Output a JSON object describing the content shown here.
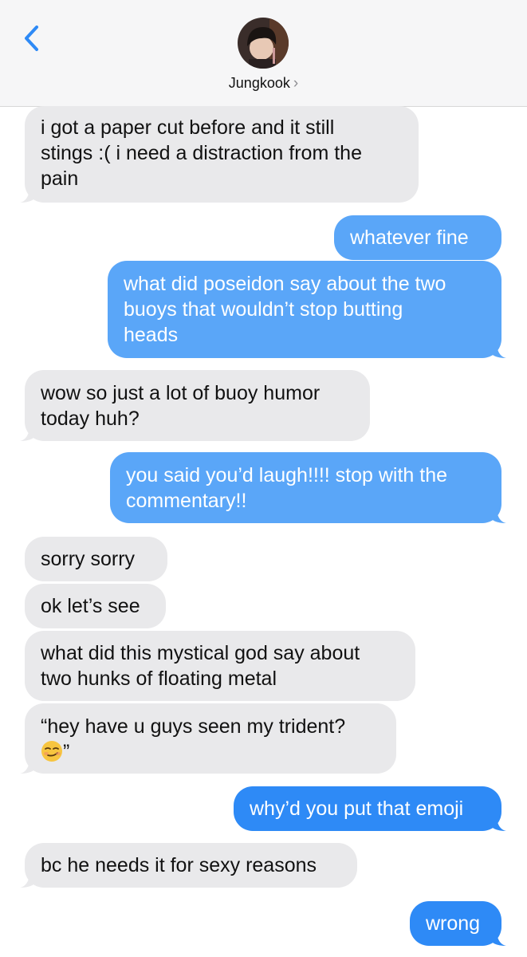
{
  "header": {
    "contact_name": "Jungkook",
    "chevron": "›",
    "back_icon": "chevron-left-icon"
  },
  "colors": {
    "incoming": "#e9e9eb",
    "outgoing": "#2e8af6",
    "back_icon": "#2e8af6"
  },
  "messages": [
    {
      "direction": "in",
      "lines": [
        "i got a paper cut before and it still",
        "stings :( i need a distraction from the",
        "pain"
      ]
    },
    {
      "direction": "out",
      "lines": [
        "whatever fine"
      ]
    },
    {
      "direction": "out",
      "lines": [
        "what did poseidon say about the two",
        "buoys that wouldn’t stop butting",
        "heads"
      ]
    },
    {
      "direction": "in",
      "lines": [
        "wow so just a lot of buoy humor",
        "today huh?"
      ]
    },
    {
      "direction": "out",
      "lines": [
        "you said you’d laugh!!!! stop with the",
        "commentary!!"
      ]
    },
    {
      "direction": "in",
      "lines": [
        "sorry sorry"
      ]
    },
    {
      "direction": "in",
      "lines": [
        "ok let’s see"
      ]
    },
    {
      "direction": "in",
      "lines": [
        "what did this mystical god say about",
        "two hunks of floating metal"
      ]
    },
    {
      "direction": "in",
      "lines": [
        "“hey have u guys seen my trident?",
        "”"
      ],
      "emoji": "smirk-emoji"
    },
    {
      "direction": "out",
      "lines": [
        "why’d you put that emoji"
      ]
    },
    {
      "direction": "in",
      "lines": [
        "bc he needs it for sexy reasons"
      ]
    },
    {
      "direction": "out",
      "lines": [
        "wrong"
      ]
    }
  ]
}
